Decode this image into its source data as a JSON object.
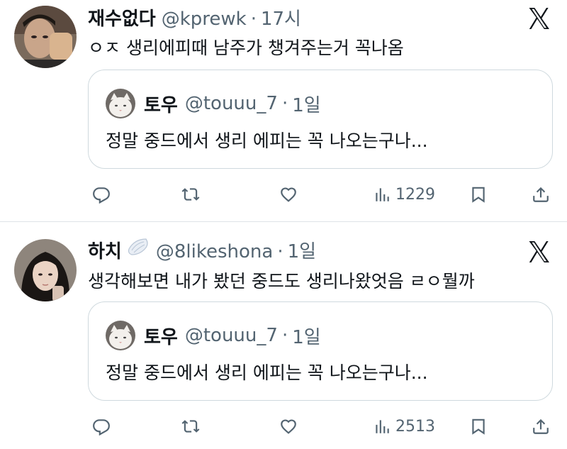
{
  "tweets": [
    {
      "name": "재수없다",
      "handle": "@kprewk",
      "separator": "·",
      "time": "17시",
      "text": "ㅇㅈ 생리에피때 남주가 챙겨주는거 꼭나옴",
      "quote": {
        "name": "토우",
        "handle": "@touuu_7",
        "separator": "·",
        "time": "1일",
        "text": "정말 중드에서 생리 에피는 꼭 나오는구나..."
      },
      "views": "1229"
    },
    {
      "name": "하치",
      "handle": "@8likeshona",
      "separator": "·",
      "time": "1일",
      "text": "생각해보면 내가 봤던 중드도 생리나왔엇음 ㄹㅇ뭘까",
      "quote": {
        "name": "토우",
        "handle": "@touuu_7",
        "separator": "·",
        "time": "1일",
        "text": "정말 중드에서 생리 에피는 꼭 나오는구나..."
      },
      "views": "2513"
    }
  ],
  "icons": {
    "platform": "x-logo-icon",
    "reply": "reply-icon",
    "retweet": "retweet-icon",
    "like": "heart-icon",
    "views": "views-icon",
    "bookmark": "bookmark-icon",
    "share": "share-icon"
  },
  "colors": {
    "text": "#0f1419",
    "secondary": "#536471",
    "border": "#cfd9de",
    "divider": "#dfe3e7"
  }
}
